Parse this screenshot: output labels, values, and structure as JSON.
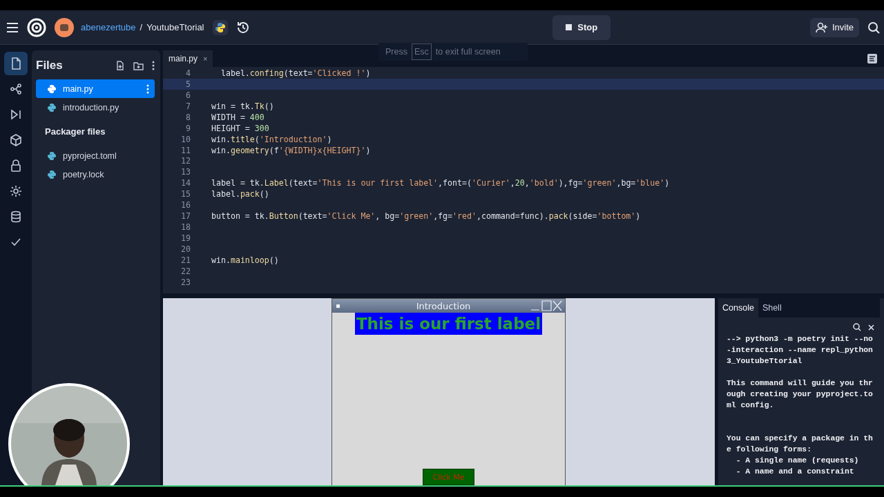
{
  "header": {
    "owner": "abenezertube",
    "separator": "/",
    "repl": "YoutubeTtorial",
    "run_button": "Stop",
    "invite_button": "Invite"
  },
  "fullscreen_toast": {
    "before": "Press",
    "key": "Esc",
    "after": "to exit full screen"
  },
  "rail": [
    {
      "kind": "files",
      "selected": true
    },
    {
      "kind": "git",
      "selected": false
    },
    {
      "kind": "debugger",
      "selected": false
    },
    {
      "kind": "packages",
      "selected": false
    },
    {
      "kind": "secrets",
      "selected": false
    },
    {
      "kind": "settings",
      "selected": false
    },
    {
      "kind": "database",
      "selected": false
    },
    {
      "kind": "tests",
      "selected": false
    }
  ],
  "files_panel": {
    "title": "Files",
    "files": [
      {
        "name": "main.py",
        "selected": true
      },
      {
        "name": "introduction.py",
        "selected": false
      }
    ],
    "section": "Packager files",
    "packager_files": [
      {
        "name": "pyproject.toml",
        "selected": false
      },
      {
        "name": "poetry.lock",
        "selected": false
      }
    ]
  },
  "editor": {
    "tab": {
      "label": "main.py",
      "close": "×"
    },
    "lines": [
      {
        "num": "4",
        "text": "  label.confing(text='Clicked !')",
        "current": false
      },
      {
        "num": "5",
        "current": true
      },
      {
        "num": "6",
        "current": false
      },
      {
        "num": "7",
        "text": "win = tk.Tk()",
        "current": false
      },
      {
        "num": "8",
        "text": "WIDTH = 400",
        "current": false
      },
      {
        "num": "9",
        "text": "HEIGHT = 300",
        "current": false
      },
      {
        "num": "10",
        "text": "win.title('Introduction')",
        "current": false
      },
      {
        "num": "11",
        "text": "win.geometry(f'{WIDTH}x{HEIGHT}')",
        "current": false
      },
      {
        "num": "12",
        "current": false
      },
      {
        "num": "13",
        "current": false
      },
      {
        "num": "14",
        "text": "label = tk.Label(text='This is our first label',font=('Curier',20,'bold'),fg='green',bg='blue')",
        "current": false
      },
      {
        "num": "15",
        "text": "label.pack()",
        "current": false
      },
      {
        "num": "16",
        "current": false
      },
      {
        "num": "17",
        "text": "button = tk.Button(text='Click Me', bg='green',fg='red',command=func).pack(side='bottom')",
        "current": false
      },
      {
        "num": "18",
        "current": false
      },
      {
        "num": "19",
        "current": false
      },
      {
        "num": "20",
        "current": false
      },
      {
        "num": "21",
        "text": "win.mainloop()",
        "current": false
      },
      {
        "num": "22",
        "current": false
      },
      {
        "num": "23",
        "current": false
      }
    ]
  },
  "preview": {
    "window_title": "Introduction",
    "label": "This is our first label",
    "button": "Click Me"
  },
  "console": {
    "tabs": [
      {
        "label": "Console",
        "selected": true
      },
      {
        "label": "Shell",
        "selected": false
      }
    ],
    "lines": [
      {
        "kind": "text",
        "text": "--> python3 -m poetry init --no"
      },
      {
        "kind": "text",
        "text": "-interaction --name repl_python"
      },
      {
        "kind": "text",
        "text": "3_YoutubeTtorial"
      },
      {
        "kind": "blank"
      },
      {
        "kind": "text",
        "text": "This command will guide you thr"
      },
      {
        "kind": "text",
        "text": "ough creating your pyproject.to"
      },
      {
        "kind": "text",
        "text": "ml config."
      },
      {
        "kind": "blank"
      },
      {
        "kind": "blank"
      },
      {
        "kind": "text",
        "text": "You can specify a package in th"
      },
      {
        "kind": "text",
        "text": "e following forms:"
      },
      {
        "kind": "text",
        "text": "  - A single name (requests)"
      },
      {
        "kind": "text",
        "text": "  - A name and a constraint"
      }
    ]
  }
}
